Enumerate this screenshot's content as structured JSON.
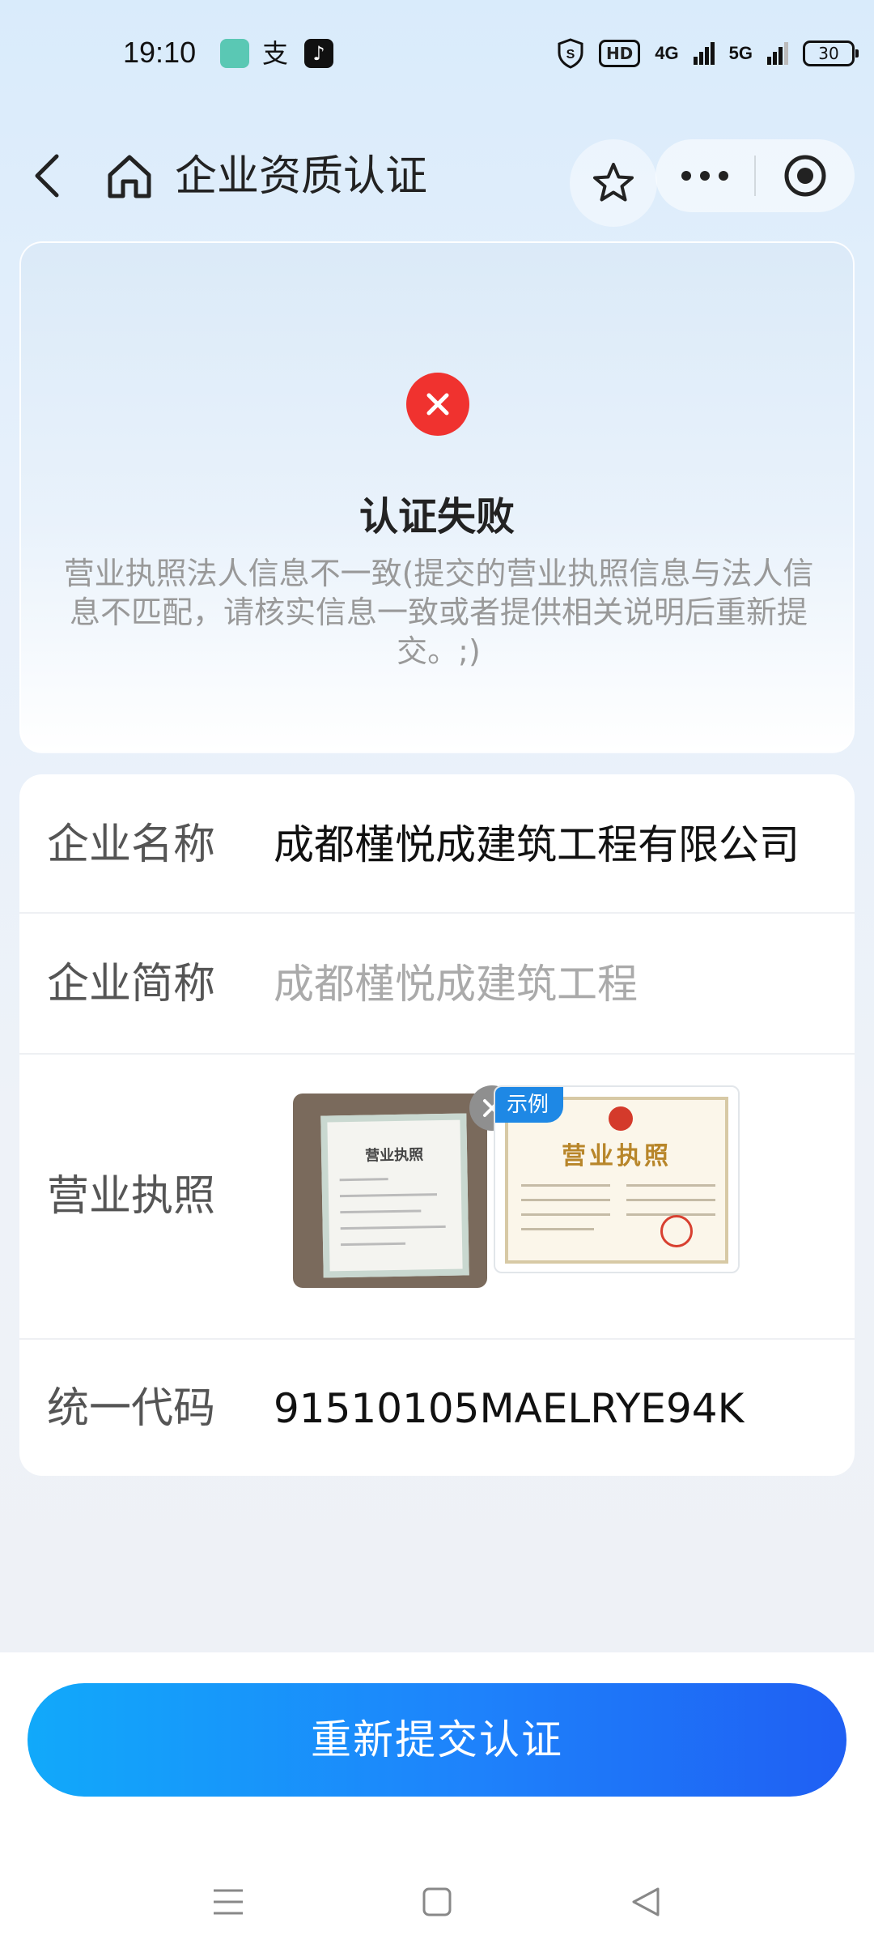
{
  "status_bar": {
    "time": "19:10",
    "app_icon_2": "支",
    "app_icon_3": "♪",
    "hd_label": "HD",
    "signal_1": "4G",
    "signal_2": "5G",
    "battery": "30"
  },
  "nav": {
    "title": "企业资质认证"
  },
  "result": {
    "title": "认证失败",
    "description": "营业执照法人信息不一致(提交的营业执照信息与法人信息不匹配，请核实信息一致或者提供相关说明后重新提交。;)",
    "status_color": "#f0322f"
  },
  "form": {
    "company_name": {
      "label": "企业名称",
      "value": "成都槿悦成建筑工程有限公司"
    },
    "short_name": {
      "label": "企业简称",
      "placeholder": "成都槿悦成建筑工程"
    },
    "license": {
      "label": "营业执照",
      "photo_cert_title": "营业执照",
      "example_tag": "示例",
      "example_cert_title": "营业执照"
    },
    "credit_code": {
      "label": "统一代码",
      "value": "91510105MAELRYE94K"
    }
  },
  "actions": {
    "resubmit_label": "重新提交认证",
    "accent_color": "#1e82fb"
  },
  "icons": [
    "back-icon",
    "home-icon",
    "star-icon",
    "more-icon",
    "target-icon",
    "error-x-icon",
    "close-icon",
    "menu-icon",
    "square-icon",
    "triangle-back-icon"
  ]
}
